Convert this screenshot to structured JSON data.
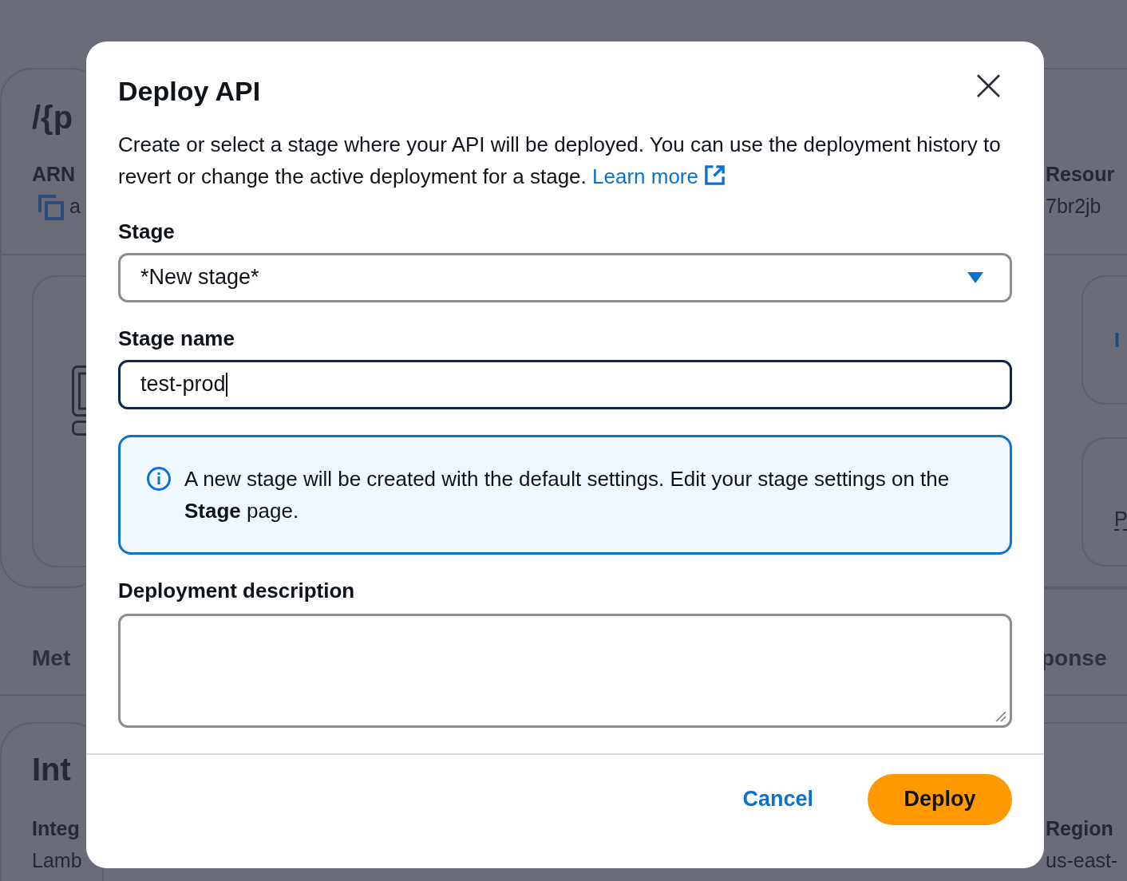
{
  "background": {
    "texts": [
      {
        "kind": "title",
        "text": "/{p"
      },
      {
        "kind": "label",
        "text": "ARN"
      },
      {
        "kind": "copy",
        "text": "a"
      },
      {
        "kind": "section",
        "text": "Met"
      },
      {
        "kind": "title",
        "text": "Int"
      },
      {
        "kind": "label",
        "text": "Integ"
      },
      {
        "kind": "value",
        "text": "Lamb"
      },
      {
        "kind": "label",
        "text": "Resour"
      },
      {
        "kind": "value",
        "text": "7br2jb"
      },
      {
        "kind": "link",
        "text": "I"
      },
      {
        "kind": "dashed",
        "text": "P"
      },
      {
        "kind": "section",
        "text": "ponse"
      },
      {
        "kind": "label",
        "text": "Region"
      },
      {
        "kind": "value",
        "text": "us-east-"
      }
    ]
  },
  "dialog": {
    "title": "Deploy API",
    "close": "×",
    "description": "Create or select a stage where your API will be deployed. You can use the deployment history to revert or change the active deployment for a stage.",
    "learn_more": "Learn more",
    "fields": [
      {
        "kind": "select",
        "label": "Stage",
        "value": "*New stage*",
        "focused": false
      },
      {
        "kind": "input",
        "label": "Stage name",
        "value": "test-prod",
        "focused": true
      },
      {
        "kind": "info",
        "text": "A new stage will be created with the default settings. Edit your stage settings on the **Stage** page."
      },
      {
        "kind": "textarea",
        "label": "Deployment description",
        "focused": false
      }
    ],
    "buttons": [
      {
        "kind": "link",
        "label": "Cancel"
      },
      {
        "kind": "primary",
        "label": "Deploy"
      }
    ]
  }
}
